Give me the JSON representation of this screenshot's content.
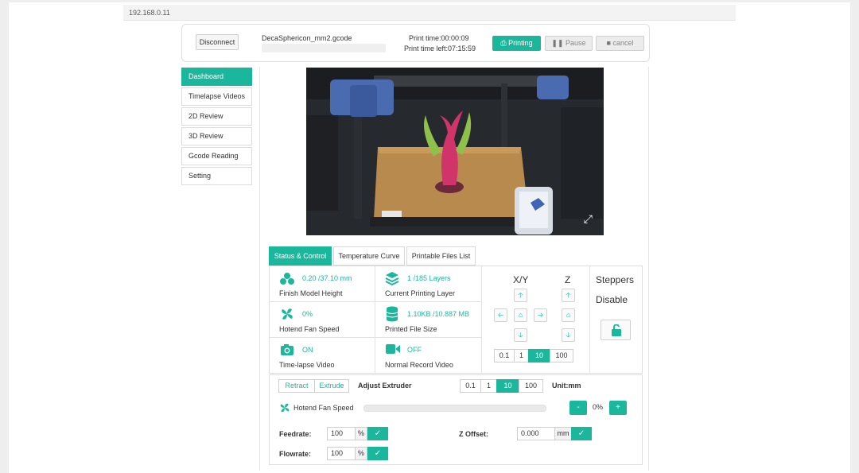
{
  "address": "192.168.0.11",
  "topbar": {
    "disconnect": "Disconnect",
    "filename": "DecaSphericon_mm2.gcode",
    "print_time": "Print time:00:00:09",
    "time_left": "Print time left:07:15:59",
    "printing": "Printing",
    "pause": "Pause",
    "cancel": "cancel"
  },
  "sidebar": {
    "items": [
      {
        "label": "Dashboard"
      },
      {
        "label": "Timelapse Videos"
      },
      {
        "label": "2D Review"
      },
      {
        "label": "3D Review"
      },
      {
        "label": "Gcode Reading"
      },
      {
        "label": "Setting"
      }
    ]
  },
  "tabs": [
    "Status & Control",
    "Temperature Curve",
    "Printable Files List"
  ],
  "status": {
    "model_height": {
      "value": "0.20 /37.10 mm",
      "label": "Finish Model Height"
    },
    "layer": {
      "value": "1 /185 Layers",
      "label": "Current Printing Layer"
    },
    "fan": {
      "value": "0%",
      "label": "Hotend Fan Speed"
    },
    "filesize": {
      "value": "1.10KB /10.887 MB",
      "label": "Printed File Size"
    },
    "timelapse": {
      "value": "ON",
      "label": "Time-lapse Video"
    },
    "record": {
      "value": "OFF",
      "label": "Normal Record Video"
    }
  },
  "motion": {
    "xy_label": "X/Y",
    "z_label": "Z",
    "steppers": "Steppers",
    "disable": "Disable",
    "steps": [
      "0.1",
      "1",
      "10",
      "100"
    ]
  },
  "extruder": {
    "retract": "Retract",
    "extrude": "Extrude",
    "adjust": "Adjust Extruder",
    "steps": [
      "0.1",
      "1",
      "10",
      "100"
    ],
    "unit": "Unit:mm",
    "fan_label": "Hotend Fan Speed",
    "fan_minus": "-",
    "fan_value": "0%",
    "fan_plus": "+",
    "feedrate_label": "Feedrate:",
    "feedrate_value": "100",
    "flowrate_label": "Flowrate:",
    "flowrate_value": "100",
    "percent": "%",
    "zoffset_label": "Z Offset:",
    "zoffset_value": "0.000",
    "mm": "mm",
    "fan_level": 0
  },
  "colors": {
    "accent": "#1bb79d"
  },
  "icons": [
    "print-icon",
    "pause-icon",
    "stop-icon",
    "layers-model-icon",
    "layers-icon",
    "fan-icon",
    "database-icon",
    "camera-icon",
    "video-icon",
    "unlock-icon",
    "home-icon",
    "check-icon",
    "fullscreen-icon"
  ]
}
